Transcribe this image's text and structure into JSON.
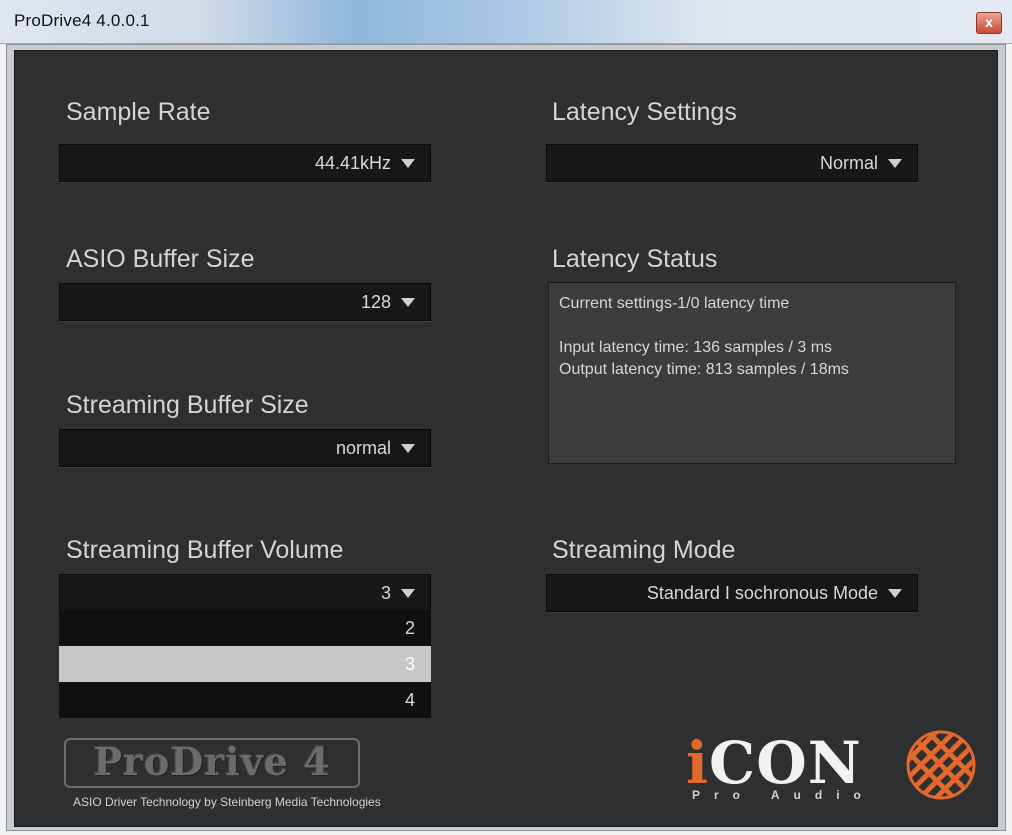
{
  "window": {
    "title": "ProDrive4 4.0.0.1",
    "close_label": "x"
  },
  "sample_rate": {
    "label": "Sample Rate",
    "value": "44.41kHz"
  },
  "asio_buffer": {
    "label": "ASIO Buffer Size",
    "value": "128"
  },
  "streaming_buffer_size": {
    "label": "Streaming Buffer Size",
    "value": "normal"
  },
  "streaming_buffer_volume": {
    "label": "Streaming Buffer Volume",
    "value": "3",
    "options": [
      "2",
      "3",
      "4"
    ],
    "selected_index": 1
  },
  "latency_settings": {
    "label": "Latency Settings",
    "value": "Normal"
  },
  "latency_status": {
    "label": "Latency Status",
    "line1": "Current settings-1/0 latency time",
    "line2": "Input latency time: 136 samples / 3 ms",
    "line3": "Output latency time: 813 samples / 18ms"
  },
  "streaming_mode": {
    "label": "Streaming Mode",
    "value": "Standard I sochronous Mode"
  },
  "branding": {
    "prodrive_logo": "ProDrive 4",
    "footer": "ASIO Driver Technology by Steinberg Media Technologies",
    "icon_logo_i": "i",
    "icon_logo_rest": "CON",
    "pro_audio": "Pro Audio"
  },
  "colors": {
    "panel": "#2e2f31",
    "dropdown": "#161718",
    "accent_orange": "#e2682b"
  }
}
